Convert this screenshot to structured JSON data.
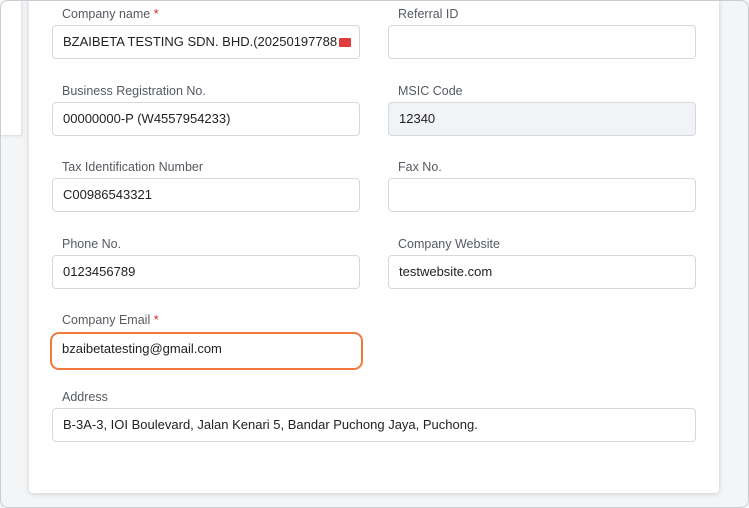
{
  "form": {
    "company_name": {
      "label": "Company name",
      "required_mark": "*",
      "value": "BZAIBETA TESTING SDN. BHD.(20250197788"
    },
    "referral_id": {
      "label": "Referral ID",
      "value": ""
    },
    "business_reg": {
      "label": "Business Registration No.",
      "value": "00000000-P (W4557954233)"
    },
    "msic_code": {
      "label": "MSIC Code",
      "value": "12340"
    },
    "tax_id": {
      "label": "Tax Identification Number",
      "value": "C00986543321"
    },
    "fax": {
      "label": "Fax No.",
      "value": ""
    },
    "phone": {
      "label": "Phone No.",
      "value": "0123456789"
    },
    "website": {
      "label": "Company Website",
      "value": "testwebsite.com"
    },
    "email": {
      "label": "Company Email",
      "required_mark": "*",
      "value": "bzaibetatesting@gmail.com"
    },
    "address": {
      "label": "Address",
      "value": "B-3A-3, IOI Boulevard, Jalan Kenari 5, Bandar Puchong Jaya, Puchong."
    }
  },
  "colors": {
    "focus_border": "#f07a3e",
    "required": "#d9292b",
    "readonly_bg": "#f1f3f6"
  },
  "icons": {
    "company_name_trailing": "flag-emoji-icon"
  }
}
